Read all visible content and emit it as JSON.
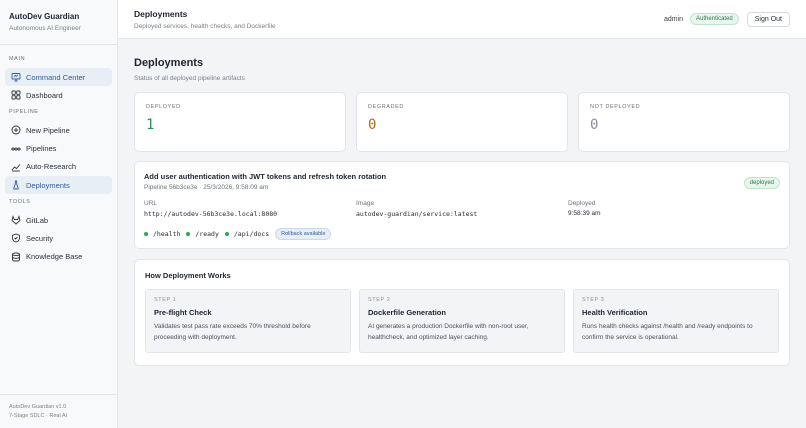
{
  "brand": {
    "title": "AutoDev Guardian",
    "subtitle": "Autonomous AI Engineer"
  },
  "sidebar": {
    "sections": [
      {
        "label": "MAIN",
        "items": [
          {
            "label": "Command Center",
            "icon": "monitor-icon",
            "active": true
          },
          {
            "label": "Dashboard",
            "icon": "grid-icon",
            "active": false
          }
        ]
      },
      {
        "label": "PIPELINE",
        "items": [
          {
            "label": "New Pipeline",
            "icon": "plus-circle-icon",
            "active": false
          },
          {
            "label": "Pipelines",
            "icon": "pipeline-icon",
            "active": false
          },
          {
            "label": "Auto-Research",
            "icon": "trend-icon",
            "active": false
          },
          {
            "label": "Deployments",
            "icon": "flask-icon",
            "active": true
          }
        ]
      },
      {
        "label": "TOOLS",
        "items": [
          {
            "label": "GitLab",
            "icon": "gitlab-icon",
            "active": false
          },
          {
            "label": "Security",
            "icon": "shield-icon",
            "active": false
          },
          {
            "label": "Knowledge Base",
            "icon": "database-icon",
            "active": false
          }
        ]
      }
    ],
    "footer": {
      "version": "AutoDev Guardian v1.0",
      "tagline": "7-Stage SDLC · Real AI"
    }
  },
  "header": {
    "title": "Deployments",
    "subtitle": "Deployed services, health checks, and Dockerfile",
    "user": "admin",
    "auth_status": "Authenticated",
    "signout_label": "Sign Out"
  },
  "page": {
    "title": "Deployments",
    "subtitle": "Status of all deployed pipeline artifacts"
  },
  "stats": [
    {
      "label": "DEPLOYED",
      "value": "1",
      "color": "#2f8f5a"
    },
    {
      "label": "DEGRADED",
      "value": "0",
      "color": "#b5651d"
    },
    {
      "label": "NOT DEPLOYED",
      "value": "0",
      "color": "#8a8f99"
    }
  ],
  "deployment": {
    "title": "Add user authentication with JWT tokens and refresh token rotation",
    "meta": "Pipeline 56b3ce3e · 25/3/2026, 9:58:09 am",
    "status": "deployed",
    "url_label": "URL",
    "url": "http://autodev-56b3ce3e.local:8080",
    "image_label": "Image",
    "image": "autodev-guardian/service:latest",
    "deployed_label": "Deployed",
    "deployed_time": "9:58:39 am",
    "endpoints": [
      "/health",
      "/ready",
      "/api/docs"
    ],
    "rollback_label": "Rollback available"
  },
  "how": {
    "title": "How Deployment Works",
    "steps": [
      {
        "label": "STEP 1",
        "title": "Pre-flight Check",
        "desc": "Validates test pass rate exceeds 70% threshold before proceeding with deployment."
      },
      {
        "label": "STEP 2",
        "title": "Dockerfile Generation",
        "desc": "AI generates a production Dockerfile with non-root user, healthcheck, and optimized layer caching."
      },
      {
        "label": "STEP 3",
        "title": "Health Verification",
        "desc": "Runs health checks against /health and /ready endpoints to confirm the service is operational."
      }
    ]
  }
}
